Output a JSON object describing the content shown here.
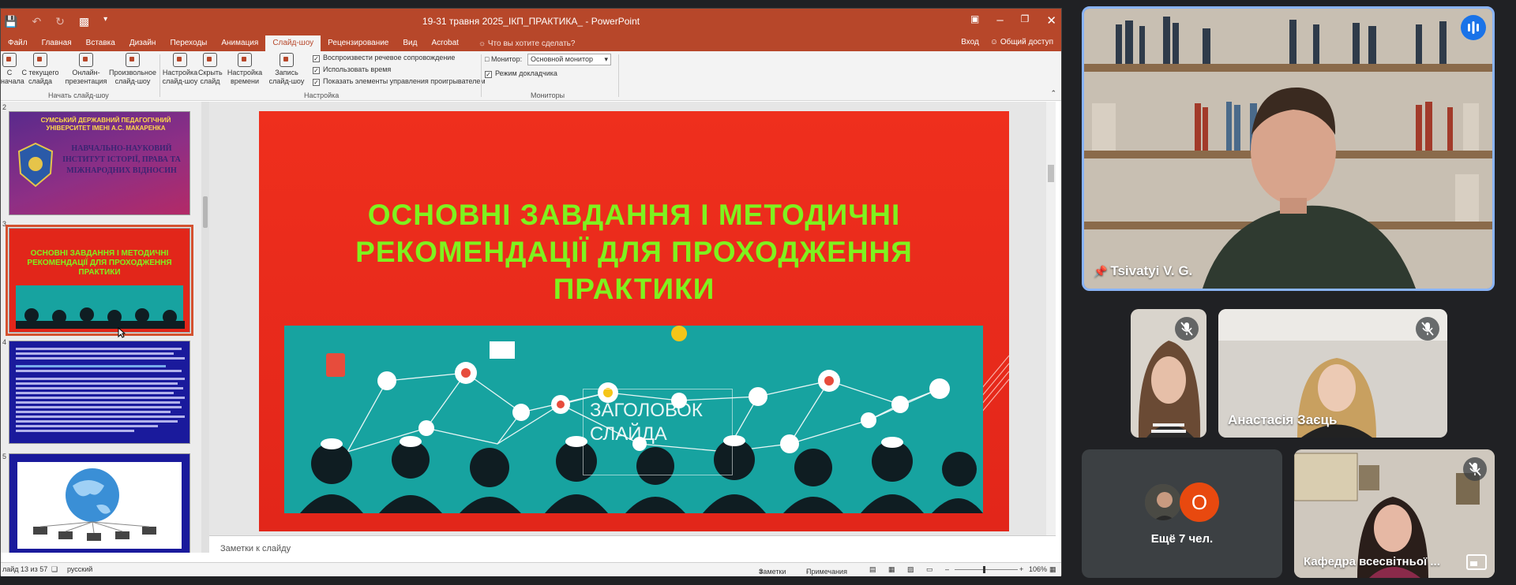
{
  "ppt": {
    "window_title": "19-31 травня 2025_ІКП_ПРАКТИКА_ - PowerPoint",
    "tabs": [
      {
        "label": "Файл"
      },
      {
        "label": "Главная"
      },
      {
        "label": "Вставка"
      },
      {
        "label": "Дизайн"
      },
      {
        "label": "Переходы"
      },
      {
        "label": "Анимация"
      },
      {
        "label": "Слайд-шоу",
        "active": true
      },
      {
        "label": "Рецензирование"
      },
      {
        "label": "Вид"
      },
      {
        "label": "Acrobat"
      }
    ],
    "help_search": "Что вы хотите сделать?",
    "sign_in": "Вход",
    "share": "Общий доступ",
    "ribbon": {
      "btn_from_start": "С начала",
      "btn_from_current": "С текущего слайда",
      "btn_online": "Онлайн-презентация",
      "btn_custom": "Произвольное слайд-шоу",
      "group_start": "Начать слайд-шоу",
      "btn_setup": "Настройка слайд-шоу",
      "btn_hide": "Скрыть слайд",
      "btn_timings": "Настройка времени",
      "btn_record": "Запись слайд-шоу",
      "chk_narration": "Воспроизвести речевое сопровождение",
      "chk_timings": "Использовать время",
      "chk_controls": "Показать элементы управления проигрывателем",
      "group_setup": "Настройка",
      "monitor_label": "Монитор:",
      "monitor_value": "Основной монитор",
      "chk_presenter": "Режим докладчика",
      "group_monitors": "Мониторы"
    },
    "thumbs": {
      "n2": "2",
      "n3": "3",
      "n4": "4",
      "n5": "5",
      "slide2_univ": "СУМСЬКИЙ ДЕРЖАВНИЙ ПЕДАГОГІЧНИЙ УНІВЕРСИТЕТ ІМЕНІ А.С. МАКАРЕНКА",
      "slide2_inst": "НАВЧАЛЬНО-НАУКОВИЙ ІНСТИТУТ ІСТОРІЇ, ПРАВА ТА МІЖНАРОДНИХ ВІДНОСИН",
      "slide3_title": "ОСНОВНІ ЗАВДАННЯ І МЕТОДИЧНІ РЕКОМЕНДАЦІЇ ДЛЯ ПРОХОДЖЕННЯ ПРАКТИКИ"
    },
    "slide": {
      "title": "ОСНОВНІ ЗАВДАННЯ І МЕТОДИЧНІ РЕКОМЕНДАЦІЇ ДЛЯ ПРОХОДЖЕННЯ ПРАКТИКИ",
      "placeholder": "ЗАГОЛОВОК СЛАЙДА"
    },
    "notes_placeholder": "Заметки к слайду",
    "status": {
      "slide_counter": "лайд 13 из 57",
      "language": "русский",
      "notes": "Заметки",
      "comments": "Примечания",
      "zoom": "106%"
    }
  },
  "participants": {
    "main_name": "Tsivatyi V. G.",
    "p2_name": "Анастасія Заєць",
    "more_label": "Ещё 7 чел.",
    "more_initial": "О",
    "p5_name": "Кафедра всесвітньої ..."
  },
  "colors": {
    "ppt_accent": "#b7472a",
    "slide_bg": "#e2261a",
    "slide_title": "#7ff21e",
    "speaking_border": "#8ab4f8",
    "avatar_orange": "#e8490f"
  }
}
